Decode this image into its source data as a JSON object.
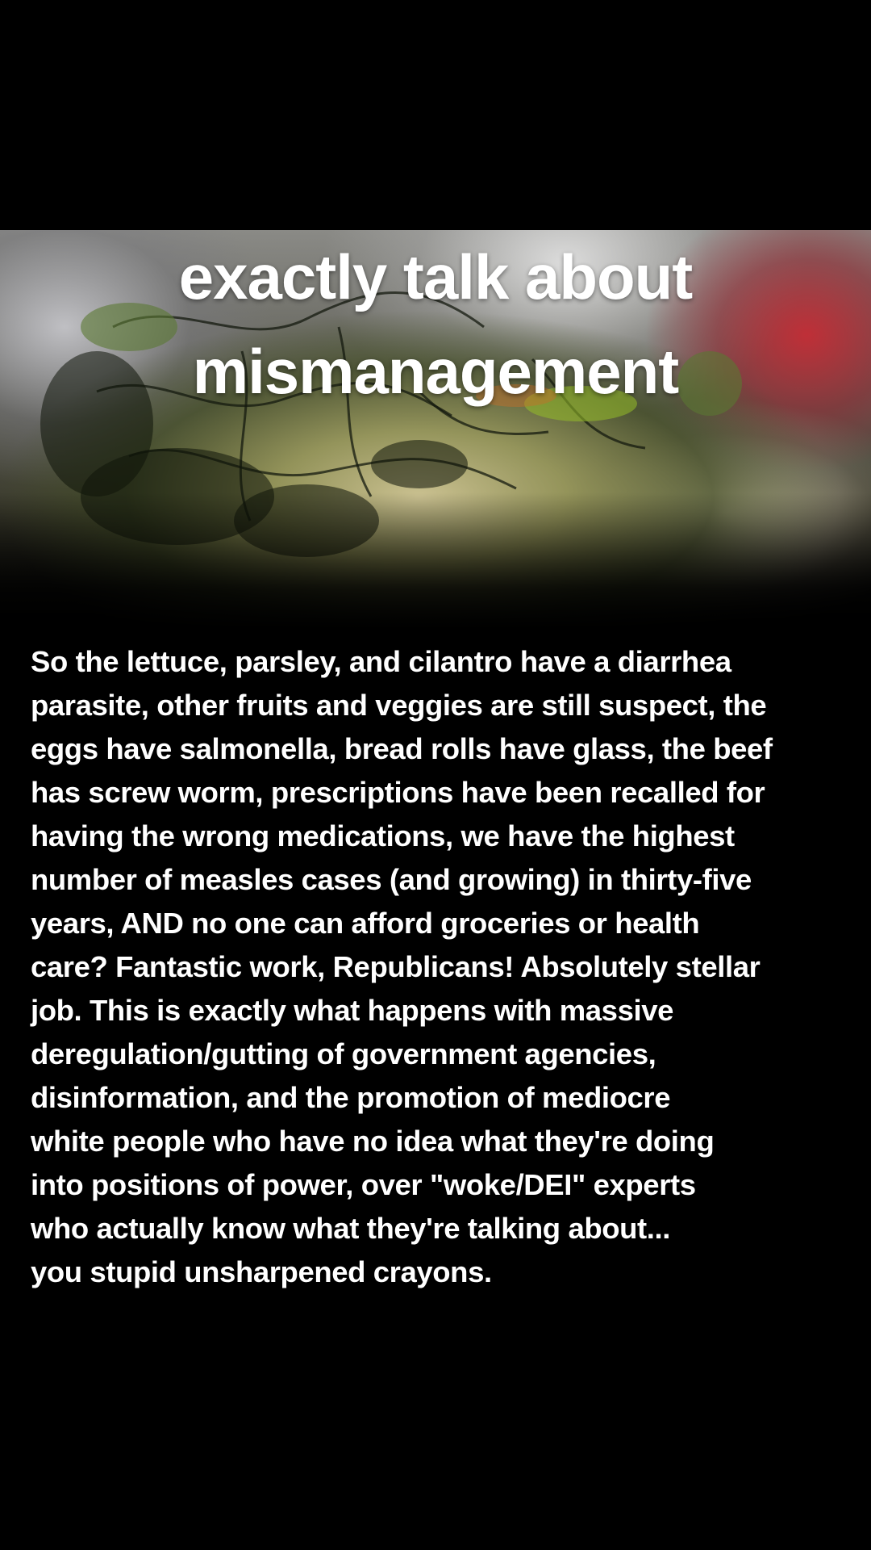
{
  "post": {
    "background_color": "#000000",
    "image": {
      "subject": "rotting lettuce on cutting board"
    },
    "title_lines": [
      "exactly talk about",
      "mismanagement"
    ],
    "body_lines": [
      "So the lettuce, parsley, and cilantro have a diarrhea",
      "parasite, other fruits and veggies are still suspect, the",
      "eggs have salmonella, bread rolls have glass, the beef",
      "has screw worm, prescriptions have been recalled for",
      "having the wrong medications, we have the highest",
      "number of measles cases (and growing) in thirty-five",
      "years, AND no one can afford groceries or health",
      "care? Fantastic work, Republicans! Absolutely stellar",
      "job. This is exactly what happens with massive",
      "deregulation/gutting of government agencies,",
      "disinformation, and the promotion of mediocre",
      "white people who have no idea what they're doing",
      "into positions of power, over \"woke/DEI\" experts",
      "who actually know what they're talking about...",
      "you stupid unsharpened crayons."
    ]
  }
}
